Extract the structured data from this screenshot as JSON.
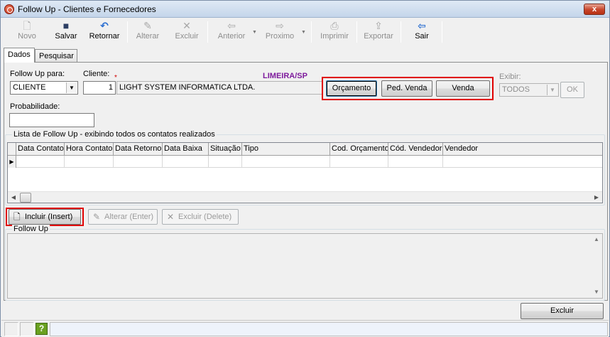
{
  "window": {
    "title": "Follow Up - Clientes e Fornecedores",
    "close_label": "x"
  },
  "toolbar": {
    "novo": "Novo",
    "salvar": "Salvar",
    "retornar": "Retornar",
    "alterar": "Alterar",
    "excluir": "Excluir",
    "anterior": "Anterior",
    "proximo": "Proximo",
    "imprimir": "Imprimir",
    "exportar": "Exportar",
    "sair": "Sair"
  },
  "tabs": [
    {
      "label": "Dados"
    },
    {
      "label": "Pesquisar"
    }
  ],
  "form": {
    "followup_para_label": "Follow Up para:",
    "followup_para_value": "CLIENTE",
    "cliente_label": "Cliente:",
    "cliente_code": "1",
    "cliente_name": "LIGHT SYSTEM INFORMATICA LTDA.",
    "required_mark": "*",
    "city": "LIMEIRA/SP",
    "probabilidade_label": "Probabilidade:",
    "probabilidade_value": "",
    "exibir_label": "Exibir:",
    "exibir_value": "TODOS",
    "ok_label": "OK"
  },
  "actions": {
    "orcamento": "Orçamento",
    "ped_venda": "Ped. Venda",
    "venda": "Venda"
  },
  "list": {
    "title": "Lista de Follow Up - exibindo todos os contatos realizados",
    "columns": [
      "Data Contato",
      "Hora Contato",
      "Data Retorno",
      "Data Baixa",
      "Situação",
      "Tipo",
      "Cod. Orçamento",
      "Cód. Vendedor",
      "Vendedor"
    ]
  },
  "list_buttons": {
    "incluir": "Incluir (Insert)",
    "alterar": "Alterar (Enter)",
    "excluir": "Excluir (Delete)"
  },
  "followup_memo": {
    "title": "Follow Up",
    "value": ""
  },
  "bottom": {
    "excluir": "Excluir"
  },
  "statusbar": {
    "help_label": "?"
  },
  "colors": {
    "highlight": "#e00000",
    "city": "#7d1a9c"
  }
}
